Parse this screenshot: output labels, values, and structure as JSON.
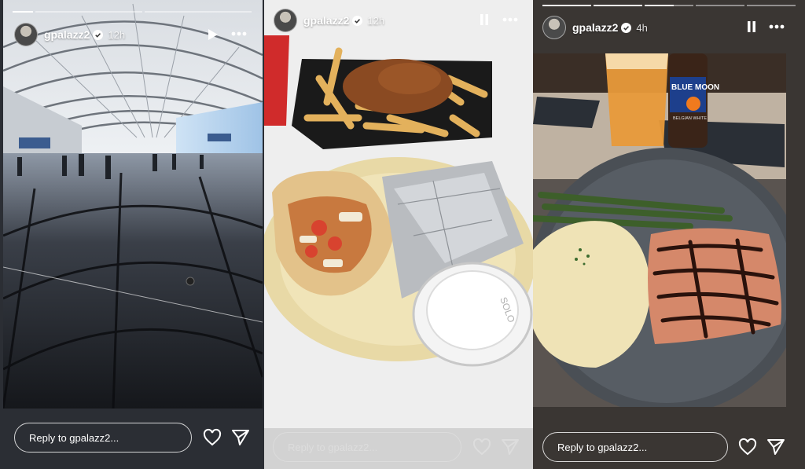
{
  "stories": [
    {
      "username": "gpalazz2",
      "timestamp": "12h",
      "reply_placeholder": "Reply to gpalazz2...",
      "playback": "paused",
      "progress_segments": 3,
      "active_segment": 0
    },
    {
      "username": "gpalazz2",
      "timestamp": "12h",
      "reply_placeholder": "Reply to gpalazz2...",
      "playback": "playing",
      "cup_lid_text": "SOLO"
    },
    {
      "username": "gpalazz2",
      "timestamp": "4h",
      "reply_placeholder": "Reply to gpalazz2...",
      "playback": "playing",
      "progress_segments": 5,
      "active_segment": 2,
      "beer_label": "BLUE MOON",
      "beer_sublabel": "BELGIAN WHITE"
    }
  ],
  "icons": {
    "verified": "verified-badge-icon",
    "play": "play-icon",
    "pause": "pause-icon",
    "more": "more-options-icon",
    "like": "heart-icon",
    "share": "send-icon"
  },
  "colors": {
    "verified": "#3897f0",
    "text": "#ffffff"
  }
}
